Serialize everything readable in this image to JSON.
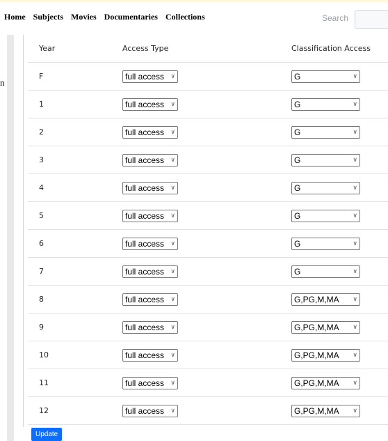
{
  "navbar": {
    "links": [
      "Home",
      "Subjects",
      "Movies",
      "Documentaries",
      "Collections"
    ],
    "search_label": "Search",
    "search_value": ""
  },
  "table": {
    "headers": [
      "Year",
      "Access Type",
      "Classification Access"
    ],
    "rows": [
      {
        "year": "F",
        "access": "full access",
        "classification": "G"
      },
      {
        "year": "1",
        "access": "full access",
        "classification": "G"
      },
      {
        "year": "2",
        "access": "full access",
        "classification": "G"
      },
      {
        "year": "3",
        "access": "full access",
        "classification": "G"
      },
      {
        "year": "4",
        "access": "full access",
        "classification": "G"
      },
      {
        "year": "5",
        "access": "full access",
        "classification": "G"
      },
      {
        "year": "6",
        "access": "full access",
        "classification": "G"
      },
      {
        "year": "7",
        "access": "full access",
        "classification": "G"
      },
      {
        "year": "8",
        "access": "full access",
        "classification": "G,PG,M,MA"
      },
      {
        "year": "9",
        "access": "full access",
        "classification": "G,PG,M,MA"
      },
      {
        "year": "10",
        "access": "full access",
        "classification": "G,PG,M,MA"
      },
      {
        "year": "11",
        "access": "full access",
        "classification": "G,PG,M,MA"
      },
      {
        "year": "12",
        "access": "full access",
        "classification": "G,PG,M,MA"
      }
    ]
  },
  "actions": {
    "update_label": "Update"
  },
  "left_edge": {
    "glyph": "n"
  },
  "icons": {
    "dropdown": "chevron-down-icon"
  },
  "colors": {
    "primary": "#0d6efd",
    "border": "#dee2e6"
  }
}
